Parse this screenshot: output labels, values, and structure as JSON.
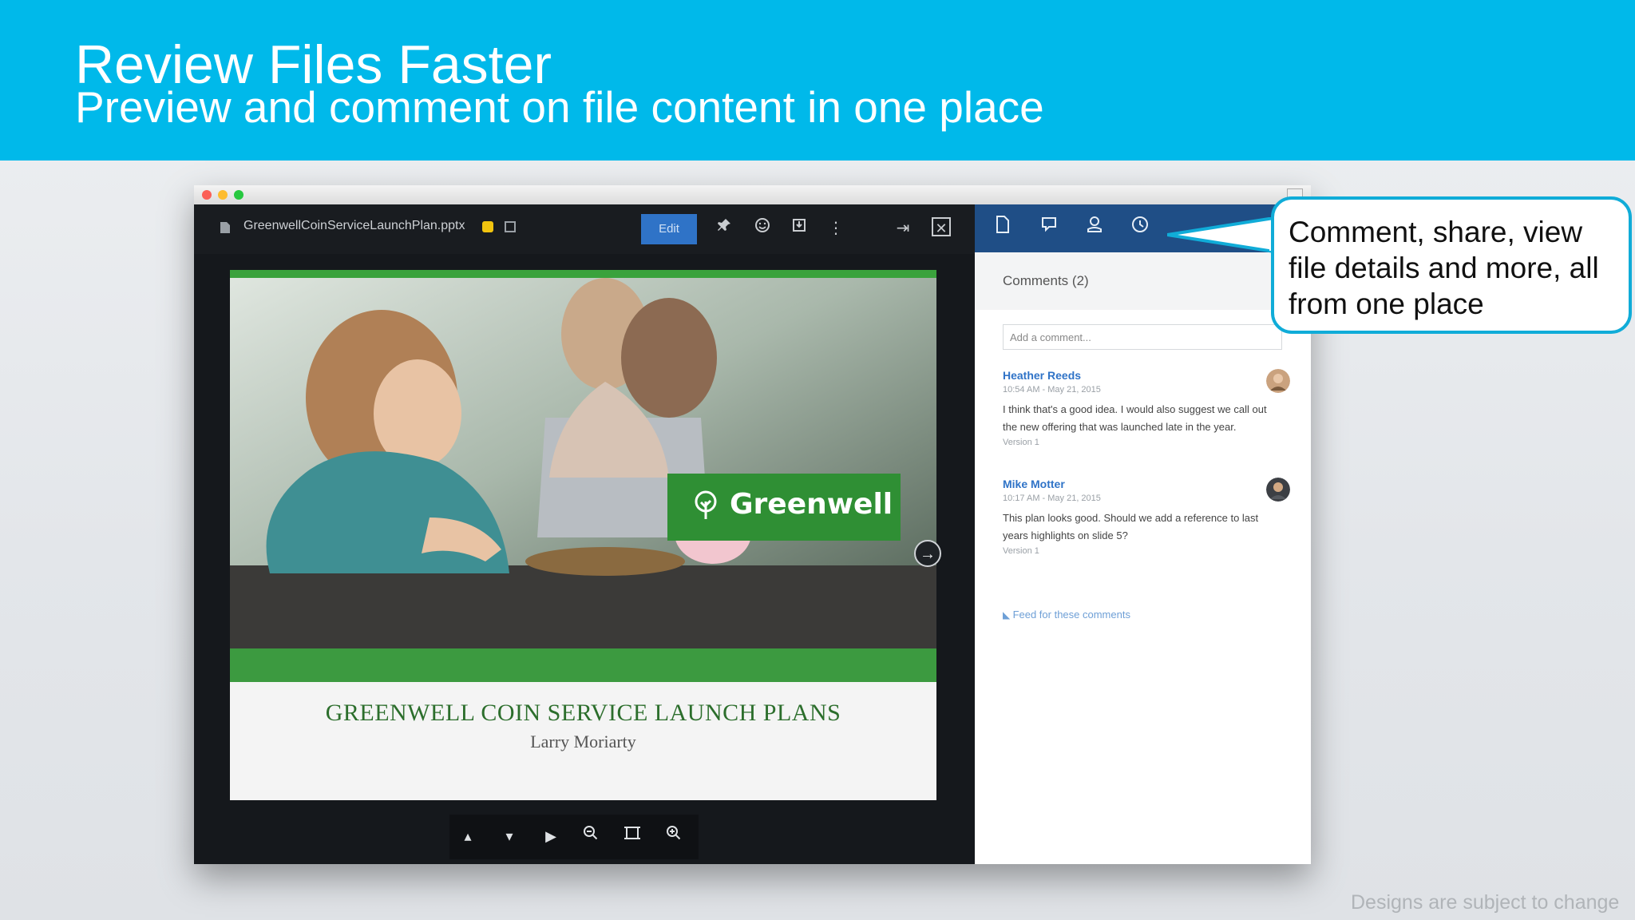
{
  "banner": {
    "title": "Review Files Faster",
    "subtitle": "Preview and comment on file content in one place"
  },
  "viewer": {
    "filename": "GreenwellCoinServiceLaunchPlan.pptx",
    "edit_label": "Edit",
    "toolbar_icons": [
      "pin-icon",
      "smiley-icon",
      "download-icon",
      "more-icon",
      "collapse-panel-icon",
      "close-icon"
    ],
    "slide": {
      "logo_text": "Greenwell",
      "title": "GREENWELL COIN SERVICE LAUNCH PLANS",
      "author": "Larry Moriarty"
    },
    "controls": [
      "prev-page-icon",
      "next-page-icon",
      "play-icon",
      "zoom-out-icon",
      "fit-to-screen-icon",
      "zoom-in-icon"
    ]
  },
  "side_panel": {
    "tabs": [
      "file-info-icon",
      "comments-icon",
      "share-icon",
      "history-icon"
    ],
    "comments_header": "Comments (2)",
    "comment_placeholder": "Add a comment...",
    "comments": [
      {
        "author": "Heather Reeds",
        "meta": "10:54 AM - May 21, 2015",
        "body": "I think that's a good idea. I would also suggest we call out the new offering that was launched late in the year.",
        "version": "Version 1"
      },
      {
        "author": "Mike Motter",
        "meta": "10:17 AM - May 21, 2015",
        "body": "This plan looks good. Should we add a reference to last years highlights on slide 5?",
        "version": "Version 1"
      }
    ],
    "feed_link": "Feed for these comments"
  },
  "callout": {
    "text": "Comment, share, view file details and more, all from one place"
  },
  "footer_note": "Designs are subject to change",
  "colors": {
    "banner": "#00b9ea",
    "side_tabs": "#1f4e86",
    "accent_blue": "#2f73c7",
    "slide_green": "#2f8f34"
  }
}
